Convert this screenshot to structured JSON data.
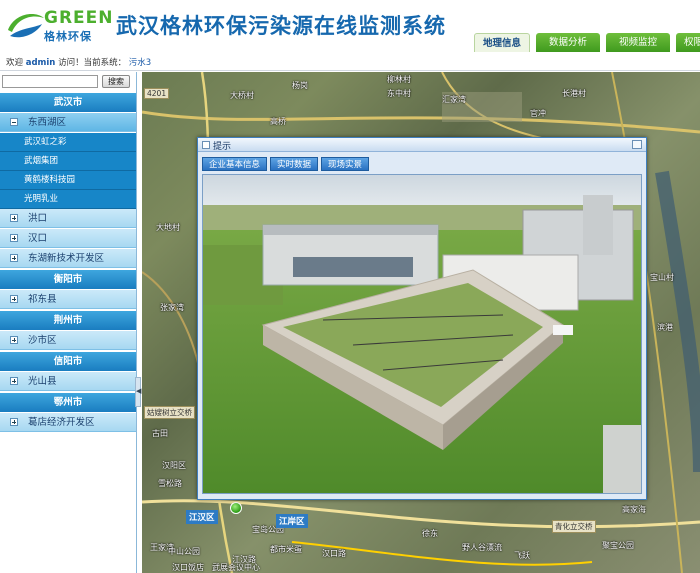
{
  "header": {
    "logo_en": "GREEN",
    "logo_cn": "格林环保",
    "system_title": "武汉格林环保污染源在线监测系统",
    "tabs": [
      "地理信息",
      "数据分析",
      "视频监控",
      "权限管"
    ]
  },
  "subbar": {
    "welcome_prefix": "欢迎",
    "user": "admin",
    "welcome_suffix": "访问！当前系统：",
    "current_system": "污水3"
  },
  "sidebar": {
    "search_button": "搜索",
    "search_value": "",
    "city1": "武汉市",
    "district_open": "东西湖区",
    "sites": [
      "武汉虹之彩",
      "武烟集团",
      "黄鹤楼科技园",
      "光明乳业"
    ],
    "districts_wuhan": [
      "洪口",
      "汉口",
      "东湖新技术开发区"
    ],
    "city2": "衡阳市",
    "district_hengyang": "祁东县",
    "city3": "荆州市",
    "district_jingzhou": "沙市区",
    "city4": "信阳市",
    "district_xinyang": "光山县",
    "city5": "鄂州市",
    "district_ezhou": "葛店经济开发区"
  },
  "map": {
    "labels": [
      "4201",
      "大桥村",
      "杨岗",
      "高桥",
      "柳林村",
      "东中村",
      "汇家湾",
      "长港村",
      "官冲",
      "大地村",
      "张家湾",
      "宝山村",
      "滨港",
      "姑嫂树立交桥",
      "古田",
      "汉阳区",
      "雪松路",
      "青化立交桥",
      "高家海",
      "野人谷漂流",
      "王家湾",
      "徐东",
      "飞跃",
      "中山公园",
      "汉口饭店",
      "都市米蛋",
      "汉口路",
      "宝岛公园",
      "武展会议中心",
      "江汉路",
      "聚宝公园"
    ],
    "district_tags": [
      "江汉区",
      "江岸区"
    ]
  },
  "popup": {
    "title": "提示",
    "tabs": [
      "企业基本信息",
      "实时数据",
      "现场实景"
    ]
  },
  "colors": {
    "brand_blue": "#1668ae",
    "brand_green": "#4caf2e",
    "sidebar_city": "#1a7dc0",
    "sidebar_site": "#1786c8"
  }
}
